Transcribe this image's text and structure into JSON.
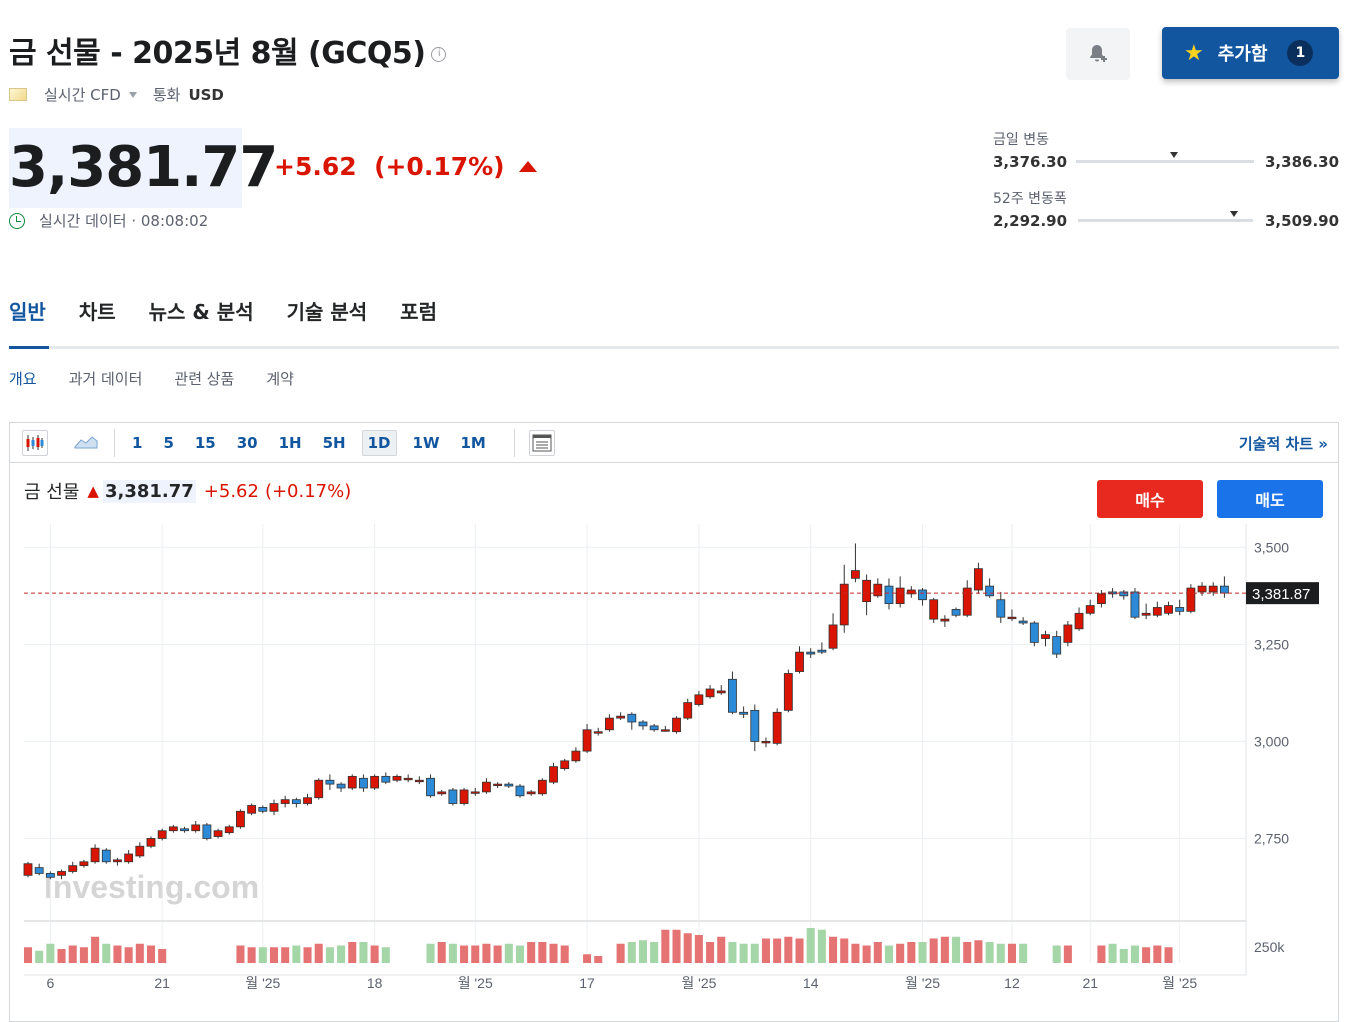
{
  "header": {
    "title": "금 선물 - 2025년 8월 (GCQ5)",
    "info_glyph": "i",
    "data_type": "실시간 CFD",
    "currency_label": "통화",
    "currency": "USD",
    "add_button": "추가함",
    "add_count": "1"
  },
  "quote": {
    "price": "3,381.77",
    "change": "+5.62",
    "change_pct": "(+0.17%)",
    "realtime_label": "실시간 데이터 · 08:08:02"
  },
  "ranges": {
    "daily_label": "금일 변동",
    "daily_low": "3,376.30",
    "daily_high": "3,386.30",
    "daily_level": 0.55,
    "week52_label": "52주 변동폭",
    "week52_low": "2,292.90",
    "week52_high": "3,509.90",
    "week52_level": 0.89
  },
  "tabs": [
    "일반",
    "차트",
    "뉴스 & 분석",
    "기술 분석",
    "포럼"
  ],
  "subtabs": [
    "개요",
    "과거 데이터",
    "관련 상품",
    "계약"
  ],
  "toolbar": {
    "intervals": [
      "1",
      "5",
      "15",
      "30",
      "1H",
      "5H",
      "1D",
      "1W",
      "1M"
    ],
    "selected": "1D",
    "tech_chart_link": "기술적 차트 »"
  },
  "chart_header": {
    "name": "금 선물",
    "arrow": "▲",
    "price": "3,381.77",
    "change": "+5.62",
    "change_pct": "(+0.17%)",
    "buy": "매수",
    "sell": "매도"
  },
  "colors": {
    "up": "#d91400",
    "down": "#2d8ad6",
    "accent": "#1256a0",
    "vol_up": "#e57373",
    "vol_down": "#a5d6a7"
  },
  "chart_data": {
    "type": "candlestick",
    "watermark": "Investing.com",
    "ylim": [
      2540,
      3560
    ],
    "y_ticks": [
      3500,
      3250,
      3000,
      2750
    ],
    "y_tick_labels": [
      "3,500",
      "3,250",
      "3,000",
      "2,750"
    ],
    "last_price_label": "3,381.87",
    "last_price": 3381.87,
    "volume_label": "250k",
    "x_labels": [
      {
        "label": "6",
        "idx": 2
      },
      {
        "label": "21",
        "idx": 12
      },
      {
        "label": "월 '25",
        "idx": 21
      },
      {
        "label": "18",
        "idx": 31
      },
      {
        "label": "월 '25",
        "idx": 40
      },
      {
        "label": "17",
        "idx": 50
      },
      {
        "label": "월 '25",
        "idx": 60
      },
      {
        "label": "14",
        "idx": 70
      },
      {
        "label": "월 '25",
        "idx": 80
      },
      {
        "label": "12",
        "idx": 88
      },
      {
        "label": "21",
        "idx": 95
      },
      {
        "label": "월 '25",
        "idx": 103
      }
    ],
    "candles": [
      [
        2655,
        2685,
        2650,
        2690
      ],
      [
        2675,
        2660,
        2655,
        2685
      ],
      [
        2660,
        2650,
        2645,
        2665
      ],
      [
        2655,
        2665,
        2645,
        2670
      ],
      [
        2665,
        2680,
        2660,
        2690
      ],
      [
        2680,
        2690,
        2675,
        2695
      ],
      [
        2690,
        2725,
        2685,
        2735
      ],
      [
        2720,
        2690,
        2685,
        2725
      ],
      [
        2690,
        2695,
        2680,
        2700
      ],
      [
        2690,
        2710,
        2685,
        2720
      ],
      [
        2705,
        2730,
        2700,
        2740
      ],
      [
        2730,
        2750,
        2725,
        2755
      ],
      [
        2750,
        2770,
        2745,
        2775
      ],
      [
        2770,
        2780,
        2765,
        2785
      ],
      [
        2775,
        2770,
        2765,
        2780
      ],
      [
        2770,
        2785,
        2765,
        2795
      ],
      [
        2785,
        2750,
        2745,
        2790
      ],
      [
        2755,
        2770,
        2750,
        2775
      ],
      [
        2765,
        2780,
        2760,
        2785
      ],
      [
        2780,
        2820,
        2775,
        2825
      ],
      [
        2815,
        2835,
        2810,
        2840
      ],
      [
        2830,
        2820,
        2815,
        2835
      ],
      [
        2820,
        2840,
        2810,
        2850
      ],
      [
        2840,
        2850,
        2830,
        2860
      ],
      [
        2850,
        2840,
        2830,
        2855
      ],
      [
        2840,
        2855,
        2835,
        2865
      ],
      [
        2855,
        2900,
        2850,
        2905
      ],
      [
        2900,
        2890,
        2875,
        2915
      ],
      [
        2890,
        2880,
        2870,
        2895
      ],
      [
        2880,
        2910,
        2875,
        2915
      ],
      [
        2905,
        2880,
        2870,
        2915
      ],
      [
        2880,
        2910,
        2875,
        2915
      ],
      [
        2910,
        2895,
        2890,
        2920
      ],
      [
        2900,
        2910,
        2895,
        2915
      ],
      [
        2905,
        2905,
        2895,
        2915
      ],
      [
        2900,
        2900,
        2890,
        2910
      ],
      [
        2905,
        2860,
        2855,
        2915
      ],
      [
        2865,
        2870,
        2860,
        2875
      ],
      [
        2875,
        2840,
        2835,
        2880
      ],
      [
        2840,
        2875,
        2835,
        2880
      ],
      [
        2870,
        2870,
        2860,
        2880
      ],
      [
        2870,
        2895,
        2865,
        2905
      ],
      [
        2890,
        2890,
        2880,
        2895
      ],
      [
        2890,
        2885,
        2880,
        2895
      ],
      [
        2885,
        2860,
        2855,
        2890
      ],
      [
        2865,
        2870,
        2860,
        2875
      ],
      [
        2865,
        2900,
        2860,
        2905
      ],
      [
        2895,
        2935,
        2890,
        2945
      ],
      [
        2930,
        2950,
        2925,
        2955
      ],
      [
        2950,
        2975,
        2945,
        2985
      ],
      [
        2975,
        3030,
        2970,
        3045
      ],
      [
        3025,
        3025,
        3015,
        3035
      ],
      [
        3030,
        3060,
        3025,
        3070
      ],
      [
        3060,
        3065,
        3055,
        3075
      ],
      [
        3070,
        3050,
        3030,
        3075
      ],
      [
        3050,
        3040,
        3030,
        3055
      ],
      [
        3040,
        3030,
        3025,
        3045
      ],
      [
        3030,
        3030,
        3025,
        3040
      ],
      [
        3025,
        3060,
        3020,
        3065
      ],
      [
        3060,
        3100,
        3055,
        3110
      ],
      [
        3095,
        3120,
        3090,
        3130
      ],
      [
        3115,
        3135,
        3110,
        3145
      ],
      [
        3125,
        3130,
        3120,
        3145
      ],
      [
        3160,
        3075,
        3070,
        3180
      ],
      [
        3075,
        3070,
        3060,
        3090
      ],
      [
        3080,
        3000,
        2975,
        3095
      ],
      [
        3000,
        3000,
        2985,
        3010
      ],
      [
        2995,
        3075,
        2990,
        3085
      ],
      [
        3080,
        3175,
        3075,
        3185
      ],
      [
        3180,
        3230,
        3175,
        3245
      ],
      [
        3230,
        3225,
        3215,
        3240
      ],
      [
        3235,
        3230,
        3225,
        3255
      ],
      [
        3240,
        3300,
        3235,
        3330
      ],
      [
        3300,
        3405,
        3280,
        3455
      ],
      [
        3420,
        3440,
        3410,
        3510
      ],
      [
        3360,
        3415,
        3325,
        3430
      ],
      [
        3375,
        3405,
        3370,
        3420
      ],
      [
        3400,
        3355,
        3340,
        3420
      ],
      [
        3355,
        3395,
        3345,
        3425
      ],
      [
        3380,
        3390,
        3370,
        3400
      ],
      [
        3390,
        3365,
        3350,
        3395
      ],
      [
        3315,
        3365,
        3305,
        3370
      ],
      [
        3310,
        3315,
        3295,
        3325
      ],
      [
        3340,
        3325,
        3320,
        3345
      ],
      [
        3325,
        3395,
        3320,
        3415
      ],
      [
        3390,
        3445,
        3380,
        3460
      ],
      [
        3400,
        3375,
        3370,
        3420
      ],
      [
        3365,
        3320,
        3305,
        3385
      ],
      [
        3320,
        3320,
        3310,
        3340
      ],
      [
        3310,
        3305,
        3300,
        3320
      ],
      [
        3305,
        3255,
        3245,
        3310
      ],
      [
        3265,
        3275,
        3245,
        3285
      ],
      [
        3270,
        3225,
        3215,
        3285
      ],
      [
        3255,
        3300,
        3245,
        3310
      ],
      [
        3290,
        3330,
        3285,
        3345
      ],
      [
        3330,
        3350,
        3325,
        3365
      ],
      [
        3355,
        3380,
        3345,
        3390
      ],
      [
        3385,
        3380,
        3370,
        3395
      ],
      [
        3385,
        3375,
        3365,
        3390
      ],
      [
        3385,
        3320,
        3315,
        3395
      ],
      [
        3325,
        3330,
        3315,
        3355
      ],
      [
        3325,
        3345,
        3320,
        3360
      ],
      [
        3330,
        3350,
        3325,
        3360
      ],
      [
        3345,
        3335,
        3325,
        3365
      ],
      [
        3335,
        3395,
        3330,
        3405
      ],
      [
        3385,
        3400,
        3375,
        3410
      ],
      [
        3385,
        3400,
        3375,
        3410
      ],
      [
        3400,
        3382,
        3370,
        3425
      ]
    ],
    "volumes": [
      0.45,
      0.35,
      0.55,
      0.4,
      0.5,
      0.45,
      0.75,
      0.55,
      0.5,
      0.45,
      0.55,
      0.5,
      0.4,
      0,
      0,
      0,
      0,
      0,
      0,
      0.5,
      0.45,
      0.45,
      0.45,
      0.45,
      0.5,
      0.45,
      0.55,
      0.45,
      0.5,
      0.6,
      0.6,
      0.5,
      0.45,
      0,
      0,
      0,
      0.55,
      0.6,
      0.55,
      0.5,
      0.5,
      0.55,
      0.5,
      0.55,
      0.5,
      0.6,
      0.6,
      0.55,
      0.5,
      0,
      0.25,
      0.2,
      0,
      0.55,
      0.6,
      0.65,
      0.6,
      0.95,
      0.95,
      0.85,
      0.8,
      0.6,
      0.75,
      0.6,
      0.55,
      0.55,
      0.7,
      0.7,
      0.75,
      0.7,
      1.0,
      0.95,
      0.75,
      0.7,
      0.55,
      0.5,
      0.6,
      0.5,
      0.55,
      0.6,
      0.6,
      0.7,
      0.75,
      0.75,
      0.6,
      0.65,
      0.6,
      0.55,
      0.55,
      0.55,
      0.0,
      0.0,
      0.5,
      0.5,
      0.0,
      0.0,
      0.5,
      0.55,
      0.4,
      0.5,
      0.45,
      0.5,
      0.45
    ]
  }
}
